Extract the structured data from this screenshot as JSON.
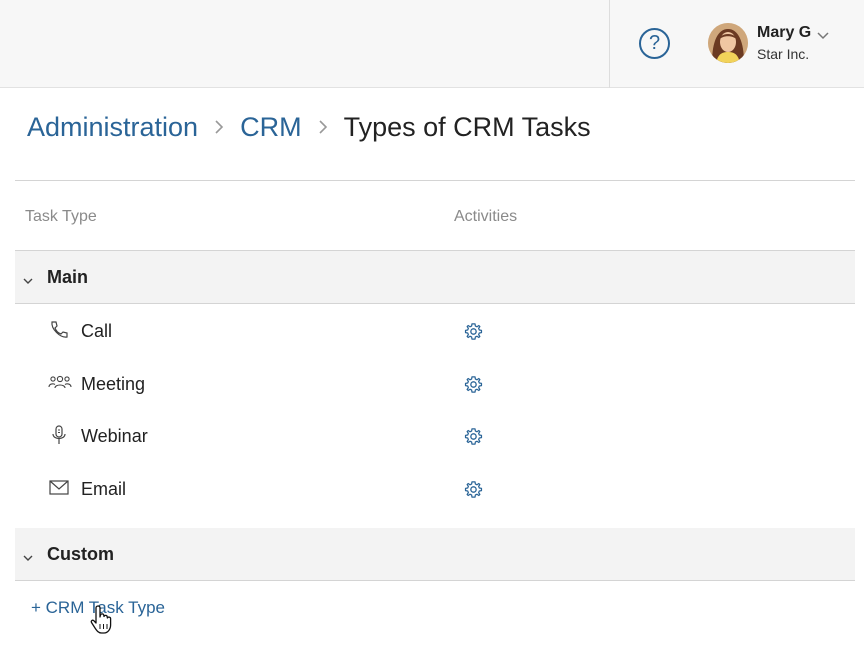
{
  "topbar": {
    "help_label": "?",
    "user": {
      "name": "Mary G",
      "org": "Star Inc."
    }
  },
  "breadcrumb": {
    "items": [
      "Administration",
      "CRM"
    ],
    "current": "Types of CRM Tasks"
  },
  "table": {
    "columns": {
      "task_type": "Task Type",
      "activities": "Activities"
    },
    "groups": [
      {
        "label": "Main",
        "rows": [
          {
            "label": "Call",
            "icon": "phone-icon"
          },
          {
            "label": "Meeting",
            "icon": "people-icon"
          },
          {
            "label": "Webinar",
            "icon": "microphone-icon"
          },
          {
            "label": "Email",
            "icon": "envelope-icon"
          }
        ]
      },
      {
        "label": "Custom",
        "rows": []
      }
    ]
  },
  "add_link": "+ CRM Task Type",
  "colors": {
    "accent": "#2a6497",
    "row_group_bg": "#f3f3f3",
    "header_bg": "#f7f7f7"
  }
}
